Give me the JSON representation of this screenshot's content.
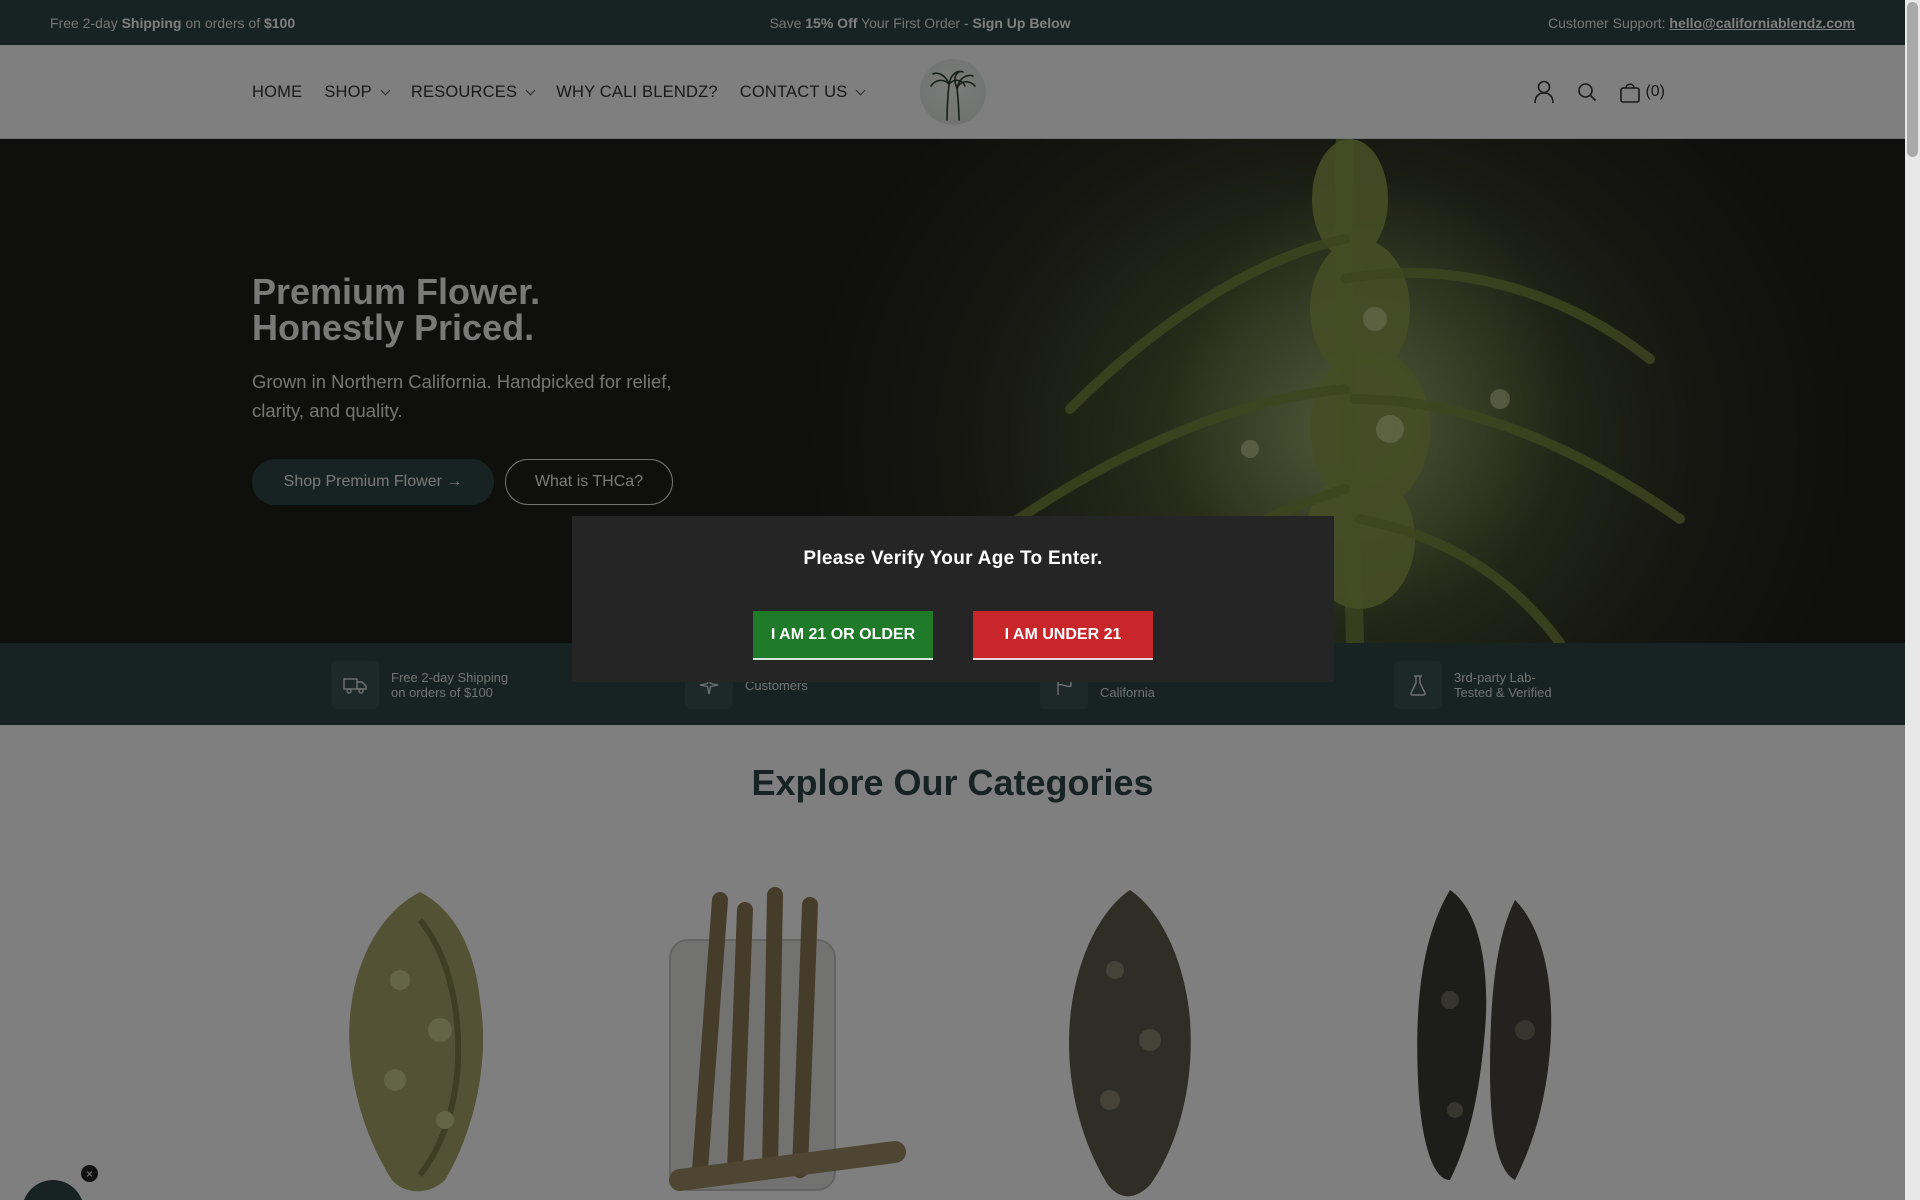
{
  "announcement": {
    "left_pre": "Free 2-day ",
    "left_bold": "Shipping",
    "left_mid": " on orders of ",
    "left_bold2": "$100",
    "center_pre": "Save ",
    "center_bold": "15% Off",
    "center_mid": " Your First Order - ",
    "center_bold2": "Sign Up Below",
    "right_pre": "Customer Support: ",
    "right_email": "hello@californiablendz.com"
  },
  "nav": {
    "home": "HOME",
    "shop": "SHOP",
    "resources": "RESOURCES",
    "why": "WHY CALI BLENDZ?",
    "contact": "CONTACT US"
  },
  "cart": {
    "count": "(0)"
  },
  "hero": {
    "title_line1": "Premium Flower.",
    "title_line2": "Honestly Priced.",
    "subtitle": "Grown in Northern California. Handpicked for relief, clarity, and quality.",
    "primary_button": "Shop Premium Flower →",
    "secondary_button": "What is THCa?"
  },
  "features": [
    {
      "icon": "truck-icon",
      "text": "Free 2-day Shipping on orders of $100"
    },
    {
      "icon": "sparkle-icon",
      "text": "Customers"
    },
    {
      "icon": "flag-icon",
      "text": "in Northern California"
    },
    {
      "icon": "flask-icon",
      "text": "3rd-party Lab-Tested & Verified"
    }
  ],
  "categories": {
    "title": "Explore Our Categories"
  },
  "age_gate": {
    "title": "Please Verify Your Age To Enter.",
    "older_button": "I AM 21 OR OLDER",
    "under_button": "I AM UNDER 21"
  },
  "chat": {
    "close": "×"
  },
  "colors": {
    "brand_green": "#2e4644",
    "older_button": "#1f7a2a",
    "under_button": "#c9262b",
    "modal_bg": "#252525"
  }
}
